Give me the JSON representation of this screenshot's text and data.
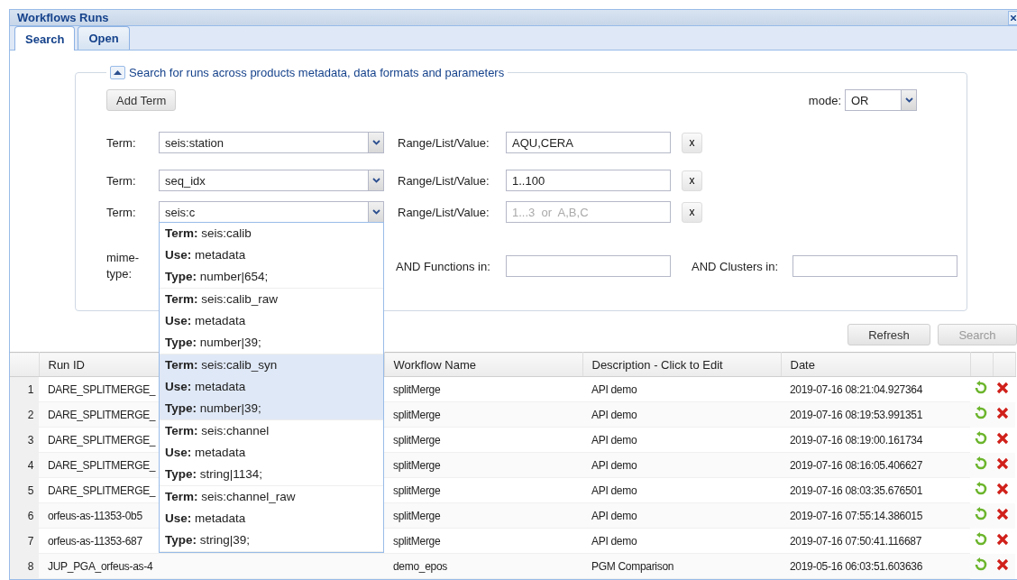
{
  "window": {
    "title": "Workflows Runs"
  },
  "tabs": [
    {
      "label": "Search",
      "selected": true
    },
    {
      "label": "Open",
      "selected": false
    }
  ],
  "search": {
    "legend": "Search for runs across products metadata, data formats and parameters",
    "expanded": true,
    "add_term": "Add Term",
    "mode": {
      "label": "mode:",
      "value": "OR"
    },
    "terms": [
      {
        "label": "Term:",
        "term": "seis:station",
        "range_label": "Range/List/Value:",
        "value": "AQU,CERA",
        "remove": "x"
      },
      {
        "label": "Term:",
        "term": "seq_idx",
        "range_label": "Range/List/Value:",
        "value": "1..100",
        "remove": "x"
      },
      {
        "label": "Term:",
        "term": "seis:c",
        "range_label": "Range/List/Value:",
        "placeholder": "1...3  or  A,B,C",
        "remove": "x",
        "open": true
      }
    ],
    "suggestions": [
      {
        "lines": [
          "**Term:** seis:calib",
          "**Use:** metadata",
          "**Type:** number|654;"
        ],
        "selected": false
      },
      {
        "lines": [
          "**Term:** seis:calib_raw",
          "**Use:** metadata",
          "**Type:** number|39;"
        ],
        "selected": false
      },
      {
        "lines": [
          "**Term:** seis:calib_syn",
          "**Use:** metadata",
          "**Type:** number|39;"
        ],
        "selected": true
      },
      {
        "lines": [
          "**Term:** seis:channel",
          "**Use:** metadata",
          "**Type:** string|1134;"
        ],
        "selected": false
      },
      {
        "lines": [
          "**Term:** seis:channel_raw",
          "**Use:** metadata",
          "**Type:** string|39;"
        ],
        "selected": false
      }
    ],
    "mime_label": "mime-type:",
    "functions_label": "AND Functions in:",
    "clusters_label": "AND Clusters in:"
  },
  "buttons": [
    {
      "label": "Refresh",
      "disabled": false
    },
    {
      "label": "Search",
      "disabled": true
    }
  ],
  "table": {
    "columns": [
      "Run ID",
      "Workflow Name",
      "Description - Click to Edit",
      "Date"
    ],
    "rows": [
      {
        "index": "1",
        "run_id": "DARE_SPLITMERGE_",
        "workflow": "splitMerge",
        "description": "API demo",
        "date": "2019-07-16 08:21:04.927364"
      },
      {
        "index": "2",
        "run_id": "DARE_SPLITMERGE_",
        "workflow": "splitMerge",
        "description": "API demo",
        "date": "2019-07-16 08:19:53.991351"
      },
      {
        "index": "3",
        "run_id": "DARE_SPLITMERGE_",
        "workflow": "splitMerge",
        "description": "API demo",
        "date": "2019-07-16 08:19:00.161734"
      },
      {
        "index": "4",
        "run_id": "DARE_SPLITMERGE_",
        "workflow": "splitMerge",
        "description": "API demo",
        "date": "2019-07-16 08:16:05.406627"
      },
      {
        "index": "5",
        "run_id": "DARE_SPLITMERGE_",
        "workflow": "splitMerge",
        "description": "API demo",
        "date": "2019-07-16 08:03:35.676501"
      },
      {
        "index": "6",
        "run_id": "orfeus-as-11353-0b5",
        "workflow": "splitMerge",
        "description": "API demo",
        "date": "2019-07-16 07:55:14.386015"
      },
      {
        "index": "7",
        "run_id": "orfeus-as-11353-687",
        "workflow": "splitMerge",
        "description": "API demo",
        "date": "2019-07-16 07:50:41.116687"
      },
      {
        "index": "8",
        "run_id": "JUP_PGA_orfeus-as-4",
        "workflow": "demo_epos",
        "description": "PGM Comparison",
        "date": "2019-05-16 06:03:51.603636"
      }
    ]
  }
}
